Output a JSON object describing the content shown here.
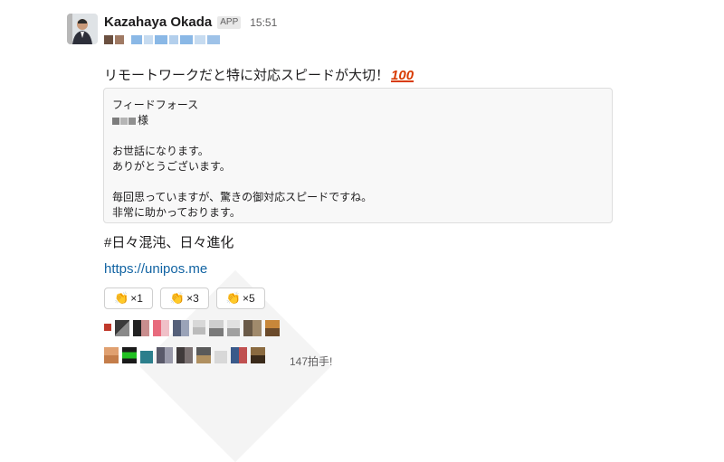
{
  "message": {
    "sender": "Kazahaya Okada",
    "badge": "APP",
    "time": "15:51",
    "text": "リモートワークだと特に対応スピードが大切！",
    "emoji": "100",
    "quote_lines": [
      "フィードフォース",
      "様",
      "",
      "お世話になります。",
      "ありがとうございます。",
      "",
      "毎回思っていますが、驚きの御対応スピードですね。",
      "非常に助かっております。"
    ],
    "hashtag": "#日々混沌、日々進化",
    "link": "https://unipos.me"
  },
  "reactions": [
    {
      "icon": "clap-icon",
      "label": "×1"
    },
    {
      "icon": "clap-icon",
      "label": "×3"
    },
    {
      "icon": "clap-icon",
      "label": "×5"
    }
  ],
  "claps_text": "147拍手!",
  "colors": {
    "link": "#1264a3",
    "badge_bg": "#e8e8e8",
    "quote_bg": "#f8f8f8",
    "emoji_100": "#d83b01"
  }
}
